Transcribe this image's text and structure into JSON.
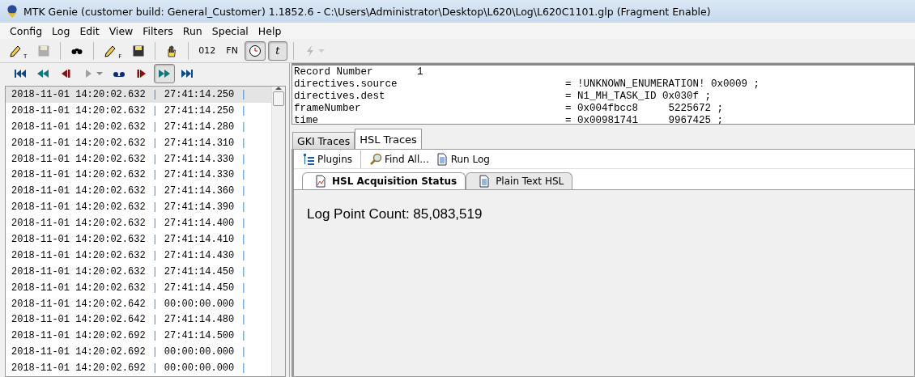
{
  "window": {
    "title": "MTK Genie (customer build: General_Customer) 1.1852.6 - C:\\Users\\Administrator\\Desktop\\L620\\Log\\L620C1101.glp (Fragment Enable)"
  },
  "menu": [
    "Config",
    "Log",
    "Edit",
    "View",
    "Filters",
    "Run",
    "Special",
    "Help"
  ],
  "toolbar": [
    {
      "kind": "icon",
      "sub": "T",
      "disabled": false,
      "on": false
    },
    {
      "kind": "icon",
      "disabled": true,
      "on": false
    },
    {
      "kind": "sep"
    },
    {
      "kind": "icon",
      "disabled": false,
      "on": false
    },
    {
      "kind": "sep"
    },
    {
      "kind": "icon",
      "sub": "F",
      "disabled": false,
      "on": false
    },
    {
      "kind": "icon",
      "disabled": false,
      "on": false
    },
    {
      "kind": "sep"
    },
    {
      "kind": "icon",
      "disabled": false,
      "on": false
    },
    {
      "kind": "sep"
    },
    {
      "kind": "text",
      "label": "012",
      "on": false
    },
    {
      "kind": "text",
      "label": "FN",
      "on": false
    },
    {
      "kind": "icon",
      "disabled": false,
      "on": true
    },
    {
      "kind": "symbol",
      "label": "t",
      "on": true
    },
    {
      "kind": "sep"
    },
    {
      "kind": "icon",
      "disabled": true,
      "on": false
    }
  ],
  "navigation": [
    {
      "on": false
    },
    {
      "on": false
    },
    {
      "on": false
    },
    {
      "on": false
    },
    {
      "on": false
    },
    {
      "on": false
    },
    {
      "on": true
    },
    {
      "on": false
    }
  ],
  "log_rows": [
    {
      "cells": [
        "2018-11-01 14:20:02.632",
        "|",
        "27:41:14.250",
        "|"
      ],
      "selected": true
    },
    {
      "cells": [
        "2018-11-01 14:20:02.632",
        "|",
        "27:41:14.250",
        "|"
      ],
      "selected": false
    },
    {
      "cells": [
        "2018-11-01 14:20:02.632",
        "|",
        "27:41:14.280",
        "|"
      ],
      "selected": false
    },
    {
      "cells": [
        "2018-11-01 14:20:02.632",
        "|",
        "27:41:14.310",
        "|"
      ],
      "selected": false
    },
    {
      "cells": [
        "2018-11-01 14:20:02.632",
        "|",
        "27:41:14.330",
        "|"
      ],
      "selected": false
    },
    {
      "cells": [
        "2018-11-01 14:20:02.632",
        "|",
        "27:41:14.330",
        "|"
      ],
      "selected": false
    },
    {
      "cells": [
        "2018-11-01 14:20:02.632",
        "|",
        "27:41:14.360",
        "|"
      ],
      "selected": false
    },
    {
      "cells": [
        "2018-11-01 14:20:02.632",
        "|",
        "27:41:14.390",
        "|"
      ],
      "selected": false
    },
    {
      "cells": [
        "2018-11-01 14:20:02.632",
        "|",
        "27:41:14.400",
        "|"
      ],
      "selected": false
    },
    {
      "cells": [
        "2018-11-01 14:20:02.632",
        "|",
        "27:41:14.410",
        "|"
      ],
      "selected": false
    },
    {
      "cells": [
        "2018-11-01 14:20:02.632",
        "|",
        "27:41:14.430",
        "|"
      ],
      "selected": false
    },
    {
      "cells": [
        "2018-11-01 14:20:02.632",
        "|",
        "27:41:14.450",
        "|"
      ],
      "selected": false
    },
    {
      "cells": [
        "2018-11-01 14:20:02.632",
        "|",
        "27:41:14.450",
        "|"
      ],
      "selected": false
    },
    {
      "cells": [
        "2018-11-01 14:20:02.642",
        "|",
        "00:00:00.000",
        "|"
      ],
      "selected": false
    },
    {
      "cells": [
        "2018-11-01 14:20:02.642",
        "|",
        "27:41:14.480",
        "|"
      ],
      "selected": false
    },
    {
      "cells": [
        "2018-11-01 14:20:02.692",
        "|",
        "27:41:14.500",
        "|"
      ],
      "selected": false
    },
    {
      "cells": [
        "2018-11-01 14:20:02.692",
        "|",
        "00:00:00.000",
        "|"
      ],
      "selected": false
    },
    {
      "cells": [
        "2018-11-01 14:20:02.692",
        "|",
        "00:00:00.000",
        "|"
      ],
      "selected": false
    }
  ],
  "record": [
    {
      "name": "Record Number",
      "value": "1",
      "kind": "header"
    },
    {
      "name": "directives.source",
      "value": "= !UNKNOWN_ENUMERATION! 0x0009 ;",
      "kind": "field"
    },
    {
      "name": "directives.dest",
      "value": "= N1_MH_TASK_ID 0x030f ;",
      "kind": "field"
    },
    {
      "name": "frameNumber",
      "value": "= 0x004fbcc8     5225672 ;",
      "kind": "field"
    },
    {
      "name": "time",
      "value": "= 0x00981741     9967425 ;",
      "kind": "field"
    }
  ],
  "tabs": [
    {
      "label": "GKI Traces",
      "selected": false
    },
    {
      "label": "HSL Traces",
      "selected": true
    }
  ],
  "hsl_toolbar": [
    "Plugins",
    "Find All...",
    "Run Log"
  ],
  "sub_tabs": [
    {
      "label": "HSL Acquisition Status",
      "selected": true
    },
    {
      "label": "Plain Text HSL",
      "selected": false
    }
  ],
  "status": {
    "text": "Log Point Count: 85,083,519"
  }
}
